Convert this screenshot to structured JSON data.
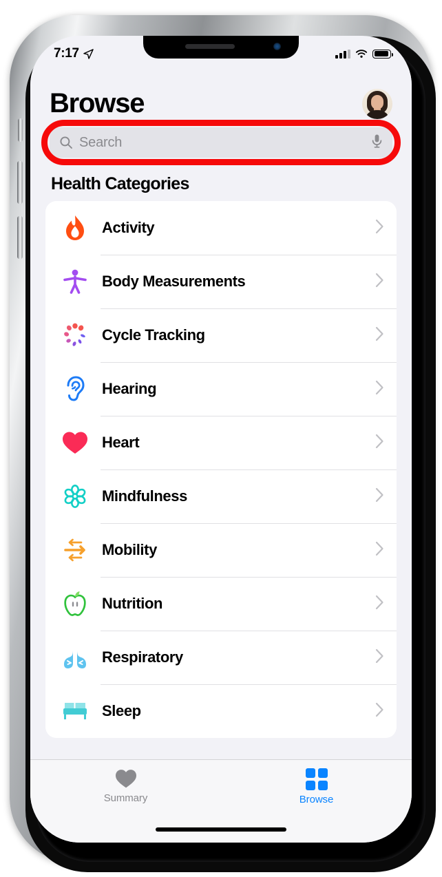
{
  "status_bar": {
    "time": "7:17",
    "location_icon": "location-arrow-icon",
    "signal_icon": "cellular-signal-icon",
    "wifi_icon": "wifi-icon",
    "battery_icon": "battery-icon"
  },
  "header": {
    "title": "Browse",
    "avatar_name": "profile-avatar"
  },
  "search": {
    "placeholder": "Search",
    "value": "",
    "search_icon": "magnifier-icon",
    "mic_icon": "microphone-icon",
    "highlight_color": "#f60a0a"
  },
  "main": {
    "section_title": "Health Categories",
    "categories": [
      {
        "label": "Activity",
        "icon": "flame-icon",
        "color": "#ff4e12"
      },
      {
        "label": "Body Measurements",
        "icon": "body-figure-icon",
        "color": "#a34cf0"
      },
      {
        "label": "Cycle Tracking",
        "icon": "cycle-petals-icon",
        "color": "#f4554f"
      },
      {
        "label": "Hearing",
        "icon": "ear-icon",
        "color": "#1d7bf6"
      },
      {
        "label": "Heart",
        "icon": "heart-icon",
        "color": "#fa2b56"
      },
      {
        "label": "Mindfulness",
        "icon": "mandala-icon",
        "color": "#12cfc6"
      },
      {
        "label": "Mobility",
        "icon": "arrows-icon",
        "color": "#f6a02c"
      },
      {
        "label": "Nutrition",
        "icon": "apple-icon",
        "color": "#30c23c"
      },
      {
        "label": "Respiratory",
        "icon": "lungs-icon",
        "color": "#5ec3ef"
      },
      {
        "label": "Sleep",
        "icon": "bed-icon",
        "color": "#42ccd4"
      }
    ]
  },
  "tab_bar": {
    "tabs": [
      {
        "label": "Summary",
        "icon": "heart-icon",
        "active": false
      },
      {
        "label": "Browse",
        "icon": "grid-icon",
        "active": true
      }
    ],
    "active_color": "#0a84ff",
    "inactive_color": "#8a8a8e"
  }
}
